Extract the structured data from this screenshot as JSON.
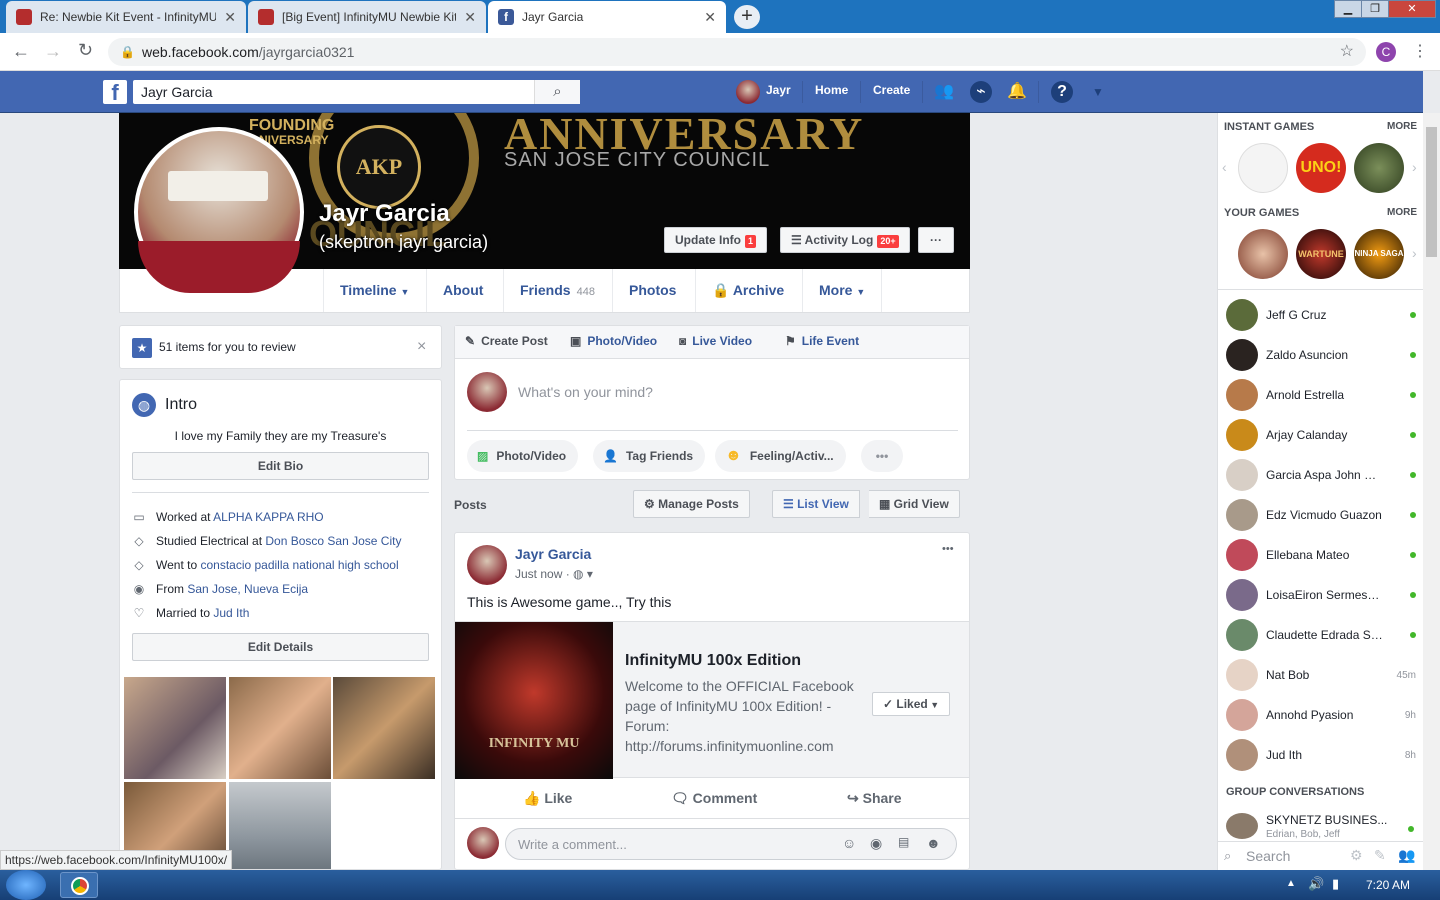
{
  "browser": {
    "tabs": [
      {
        "title": "Re: Newbie Kit Event - InfinityMU",
        "favicon_color": "#b42d2d"
      },
      {
        "title": "[Big Event] InfinityMU Newbie Kit",
        "favicon_color": "#b42d2d"
      },
      {
        "title": "Jayr Garcia",
        "favicon_color": "#3b5998"
      }
    ],
    "new_tab": "+",
    "url_host": "web.facebook.com",
    "url_path": "/jayrgarcia0321",
    "profile_initial": "C",
    "status_url": "https://web.facebook.com/InfinityMU100x/"
  },
  "fb_nav": {
    "logo": "f",
    "search_value": "Jayr Garcia",
    "user": "Jayr",
    "home": "Home",
    "create": "Create"
  },
  "profile": {
    "name": "Jayr Garcia",
    "alt_name": "(skeptron jayr garcia)",
    "cover_text_big": "ANNIVERSARY",
    "cover_text_sub": "SAN JOSE CITY COUNCIL",
    "cover_text_left": "FOUNDING",
    "cover_text_left2": "NIVERSARY",
    "cover_text_bottom": "OUNCIL",
    "cover_seal": "AKΡ",
    "update_info": "Update Info",
    "update_info_badge": "1",
    "activity_log": "Activity Log",
    "activity_log_badge": "20+",
    "more_dots": "···",
    "tabs": {
      "timeline": "Timeline",
      "about": "About",
      "friends": "Friends",
      "friends_count": "448",
      "photos": "Photos",
      "archive": "Archive",
      "more": "More"
    }
  },
  "review": {
    "text": "51 items for you to review",
    "close": "×"
  },
  "intro": {
    "title": "Intro",
    "bio": "I love my Family they are my Treasure's",
    "edit_bio": "Edit Bio",
    "worked_prefix": "Worked at ",
    "worked": "ALPHA KAPPA RHO",
    "studied_prefix": "Studied Electrical at ",
    "studied": "Don Bosco San Jose City",
    "went_prefix": "Went to ",
    "went": "constacio padilla national high school",
    "from_prefix": "From ",
    "from": "San Jose, Nueva Ecija",
    "married_prefix": "Married to ",
    "married": "Jud Ith",
    "edit_details": "Edit Details"
  },
  "composer": {
    "create_post": "Create Post",
    "photo_video": "Photo/Video",
    "live_video": "Live Video",
    "life_event": "Life Event",
    "placeholder": "What's on your mind?",
    "pill_photo": "Photo/Video",
    "pill_tag": "Tag Friends",
    "pill_feeling": "Feeling/Activ...",
    "pill_more": "•••"
  },
  "posts_header": {
    "label": "Posts",
    "manage": "Manage Posts",
    "list_view": "List View",
    "grid_view": "Grid View"
  },
  "post": {
    "author": "Jayr Garcia",
    "time": "Just now · ",
    "text": "This is Awesome game.., Try this",
    "options": "•••",
    "page_title": "InfinityMU 100x Edition",
    "page_desc": "Welcome to the OFFICIAL Facebook page of InfinityMU 100x Edition! - Forum: http://forums.infinitymuonline.com",
    "liked": "Liked",
    "logo_text": "INFINITY MU",
    "like": "Like",
    "comment": "Comment",
    "share": "Share",
    "comment_placeholder": "Write a comment..."
  },
  "sidebar": {
    "instant_games": "INSTANT GAMES",
    "your_games": "YOUR GAMES",
    "more": "MORE",
    "game_uno": "UNO!",
    "game_warture": "WARTUNE",
    "game_ninja": "NINJA SAGA",
    "friends": [
      {
        "name": "Jeff G Cruz",
        "status": ""
      },
      {
        "name": "Zaldo Asuncion",
        "status": ""
      },
      {
        "name": "Arnold Estrella",
        "status": ""
      },
      {
        "name": "Arjay Calanday",
        "status": ""
      },
      {
        "name": "Garcia Aspa John Ra...",
        "status": ""
      },
      {
        "name": "Edz Vicmudo Guazon",
        "status": ""
      },
      {
        "name": "Ellebana Mateo",
        "status": ""
      },
      {
        "name": "LoisaEiron Sermese ...",
        "status": ""
      },
      {
        "name": "Claudette Edrada Su...",
        "status": ""
      },
      {
        "name": "Nat Bob",
        "status": "45m"
      },
      {
        "name": "Annohd Pyasion",
        "status": "9h"
      },
      {
        "name": "Jud Ith",
        "status": "8h"
      }
    ],
    "group_conversations": "GROUP CONVERSATIONS",
    "group_name": "SKYNETZ BUSINES...",
    "group_members": "Edrian, Bob, Jeff",
    "search": "Search"
  },
  "taskbar": {
    "time": "7:20 AM"
  }
}
